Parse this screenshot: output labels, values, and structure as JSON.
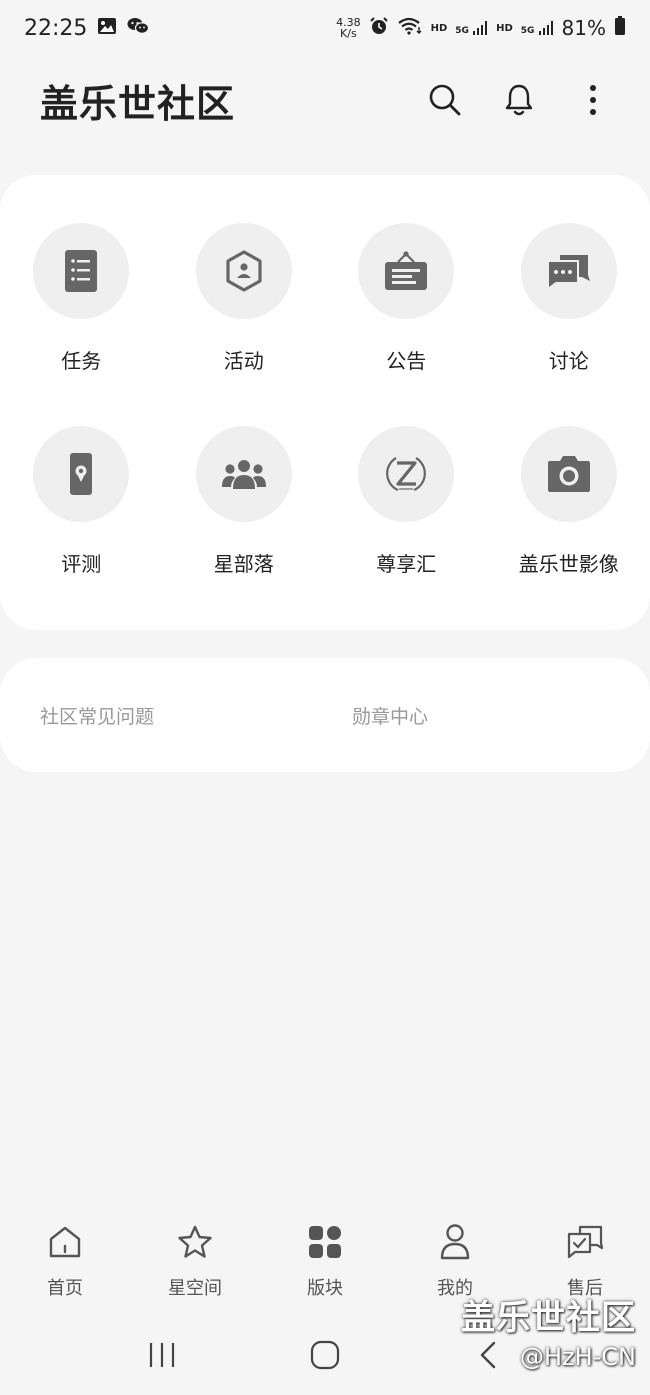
{
  "status_bar": {
    "time": "22:25",
    "net_speed_value": "4.38",
    "net_speed_unit": "K/s",
    "hd1": "HD",
    "sig1": "5G",
    "hd2": "HD",
    "sig2": "5G",
    "battery": "81%"
  },
  "header": {
    "title": "盖乐世社区"
  },
  "grid": {
    "items": [
      {
        "label": "任务",
        "icon": "task-list-icon"
      },
      {
        "label": "活动",
        "icon": "activity-hexagon-icon"
      },
      {
        "label": "公告",
        "icon": "announcement-board-icon"
      },
      {
        "label": "讨论",
        "icon": "discussion-chat-icon"
      },
      {
        "label": "评测",
        "icon": "phone-review-icon"
      },
      {
        "label": "星部落",
        "icon": "group-people-icon"
      },
      {
        "label": "尊享汇",
        "icon": "z-premium-icon"
      },
      {
        "label": "盖乐世影像",
        "icon": "camera-icon"
      }
    ]
  },
  "links": {
    "faq": "社区常见问题",
    "badges": "勋章中心"
  },
  "bottom_nav": {
    "items": [
      {
        "label": "首页",
        "icon": "home-icon"
      },
      {
        "label": "星空间",
        "icon": "star-icon"
      },
      {
        "label": "版块",
        "icon": "grid-blocks-icon"
      },
      {
        "label": "我的",
        "icon": "person-icon"
      },
      {
        "label": "售后",
        "icon": "after-sales-chat-icon"
      }
    ]
  },
  "watermark": {
    "title": "盖乐世社区",
    "sub": "@HzH-CN"
  }
}
